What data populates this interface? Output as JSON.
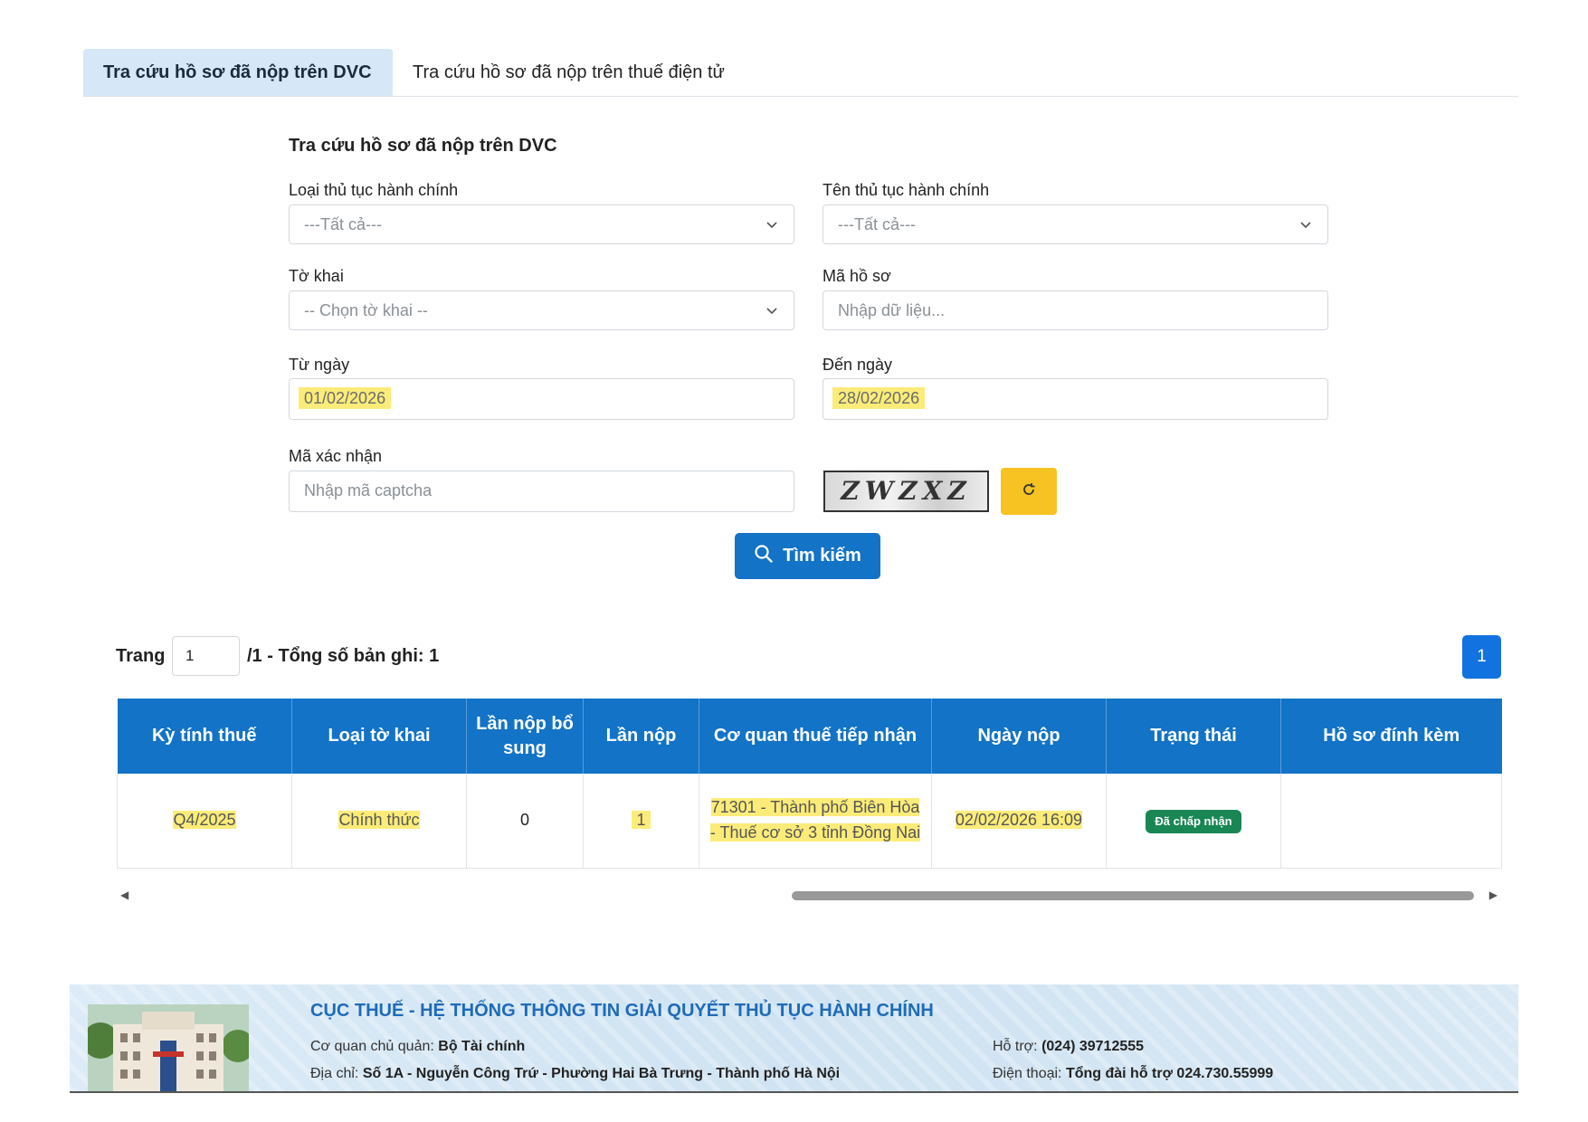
{
  "tabs": [
    {
      "label": "Tra cứu hồ sơ đã nộp trên DVC"
    },
    {
      "label": "Tra cứu hồ sơ đã nộp trên thuế điện tử"
    }
  ],
  "form": {
    "title": "Tra cứu hồ sơ đã nộp trên DVC",
    "procedure_type": {
      "label": "Loại thủ tục hành chính",
      "value": "---Tất cả---"
    },
    "procedure_name": {
      "label": "Tên thủ tục hành chính",
      "value": "---Tất cả---"
    },
    "declaration": {
      "label": "Tờ khai",
      "value": "-- Chọn tờ khai --"
    },
    "record_code": {
      "label": "Mã hồ sơ",
      "placeholder": "Nhập dữ liệu..."
    },
    "from_date": {
      "label": "Từ ngày",
      "value": "01/02/2026"
    },
    "to_date": {
      "label": "Đến ngày",
      "value": "28/02/2026"
    },
    "captcha": {
      "label": "Mã xác nhận",
      "placeholder": "Nhập mã captcha",
      "image_text": "ZWZXZ"
    },
    "search_label": "Tìm kiếm"
  },
  "pager": {
    "label": "Trang",
    "current": "1",
    "summary": "/1 - Tổng số bản ghi: 1",
    "page_button": "1"
  },
  "table": {
    "headers": [
      "Kỳ tính thuế",
      "Loại tờ khai",
      "Lần nộp bổ sung",
      "Lần nộp",
      "Cơ quan thuế tiếp nhận",
      "Ngày nộp",
      "Trạng thái",
      "Hồ sơ đính kèm"
    ],
    "rows": [
      {
        "period": "Q4/2025",
        "type": "Chính thức",
        "supplement": "0",
        "times": "1",
        "agency": "71301 - Thành phố Biên Hòa - Thuế cơ sở 3 tỉnh Đồng Nai",
        "date": "02/02/2026 16:09",
        "status": "Đã chấp nhận",
        "attachment": ""
      }
    ]
  },
  "footer": {
    "title": "CỤC THUẾ - HỆ THỐNG THÔNG TIN GIẢI QUYẾT THỦ TỤC HÀNH CHÍNH",
    "owner_label": "Cơ quan chủ quản:",
    "owner_value": "Bộ Tài chính",
    "address_label": "Địa chỉ:",
    "address_value": "Số 1A - Nguyễn Công Trứ - Phường Hai Bà Trưng - Thành phố Hà Nội",
    "support_label": "Hỗ trợ:",
    "support_value": "(024) 39712555",
    "phone_label": "Điện thoại:",
    "phone_value": "Tổng đài hỗ trợ 024.730.55999"
  },
  "colors": {
    "primary": "#1273c7",
    "highlight": "#fbec7a",
    "accept": "#198754",
    "captcha_btn": "#f7c323"
  }
}
